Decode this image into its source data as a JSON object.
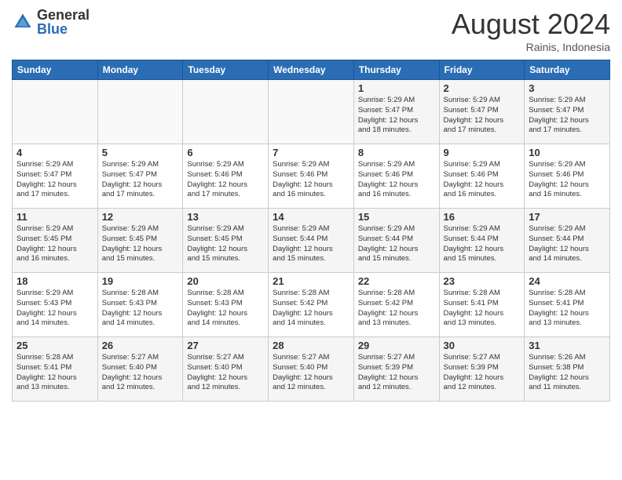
{
  "header": {
    "logo": {
      "general": "General",
      "blue": "Blue"
    },
    "title": "August 2024",
    "subtitle": "Rainis, Indonesia"
  },
  "calendar": {
    "weekdays": [
      "Sunday",
      "Monday",
      "Tuesday",
      "Wednesday",
      "Thursday",
      "Friday",
      "Saturday"
    ],
    "weeks": [
      [
        {
          "day": "",
          "info": ""
        },
        {
          "day": "",
          "info": ""
        },
        {
          "day": "",
          "info": ""
        },
        {
          "day": "",
          "info": ""
        },
        {
          "day": "1",
          "info": "Sunrise: 5:29 AM\nSunset: 5:47 PM\nDaylight: 12 hours\nand 18 minutes."
        },
        {
          "day": "2",
          "info": "Sunrise: 5:29 AM\nSunset: 5:47 PM\nDaylight: 12 hours\nand 17 minutes."
        },
        {
          "day": "3",
          "info": "Sunrise: 5:29 AM\nSunset: 5:47 PM\nDaylight: 12 hours\nand 17 minutes."
        }
      ],
      [
        {
          "day": "4",
          "info": "Sunrise: 5:29 AM\nSunset: 5:47 PM\nDaylight: 12 hours\nand 17 minutes."
        },
        {
          "day": "5",
          "info": "Sunrise: 5:29 AM\nSunset: 5:47 PM\nDaylight: 12 hours\nand 17 minutes."
        },
        {
          "day": "6",
          "info": "Sunrise: 5:29 AM\nSunset: 5:46 PM\nDaylight: 12 hours\nand 17 minutes."
        },
        {
          "day": "7",
          "info": "Sunrise: 5:29 AM\nSunset: 5:46 PM\nDaylight: 12 hours\nand 16 minutes."
        },
        {
          "day": "8",
          "info": "Sunrise: 5:29 AM\nSunset: 5:46 PM\nDaylight: 12 hours\nand 16 minutes."
        },
        {
          "day": "9",
          "info": "Sunrise: 5:29 AM\nSunset: 5:46 PM\nDaylight: 12 hours\nand 16 minutes."
        },
        {
          "day": "10",
          "info": "Sunrise: 5:29 AM\nSunset: 5:46 PM\nDaylight: 12 hours\nand 16 minutes."
        }
      ],
      [
        {
          "day": "11",
          "info": "Sunrise: 5:29 AM\nSunset: 5:45 PM\nDaylight: 12 hours\nand 16 minutes."
        },
        {
          "day": "12",
          "info": "Sunrise: 5:29 AM\nSunset: 5:45 PM\nDaylight: 12 hours\nand 15 minutes."
        },
        {
          "day": "13",
          "info": "Sunrise: 5:29 AM\nSunset: 5:45 PM\nDaylight: 12 hours\nand 15 minutes."
        },
        {
          "day": "14",
          "info": "Sunrise: 5:29 AM\nSunset: 5:44 PM\nDaylight: 12 hours\nand 15 minutes."
        },
        {
          "day": "15",
          "info": "Sunrise: 5:29 AM\nSunset: 5:44 PM\nDaylight: 12 hours\nand 15 minutes."
        },
        {
          "day": "16",
          "info": "Sunrise: 5:29 AM\nSunset: 5:44 PM\nDaylight: 12 hours\nand 15 minutes."
        },
        {
          "day": "17",
          "info": "Sunrise: 5:29 AM\nSunset: 5:44 PM\nDaylight: 12 hours\nand 14 minutes."
        }
      ],
      [
        {
          "day": "18",
          "info": "Sunrise: 5:29 AM\nSunset: 5:43 PM\nDaylight: 12 hours\nand 14 minutes."
        },
        {
          "day": "19",
          "info": "Sunrise: 5:28 AM\nSunset: 5:43 PM\nDaylight: 12 hours\nand 14 minutes."
        },
        {
          "day": "20",
          "info": "Sunrise: 5:28 AM\nSunset: 5:43 PM\nDaylight: 12 hours\nand 14 minutes."
        },
        {
          "day": "21",
          "info": "Sunrise: 5:28 AM\nSunset: 5:42 PM\nDaylight: 12 hours\nand 14 minutes."
        },
        {
          "day": "22",
          "info": "Sunrise: 5:28 AM\nSunset: 5:42 PM\nDaylight: 12 hours\nand 13 minutes."
        },
        {
          "day": "23",
          "info": "Sunrise: 5:28 AM\nSunset: 5:41 PM\nDaylight: 12 hours\nand 13 minutes."
        },
        {
          "day": "24",
          "info": "Sunrise: 5:28 AM\nSunset: 5:41 PM\nDaylight: 12 hours\nand 13 minutes."
        }
      ],
      [
        {
          "day": "25",
          "info": "Sunrise: 5:28 AM\nSunset: 5:41 PM\nDaylight: 12 hours\nand 13 minutes."
        },
        {
          "day": "26",
          "info": "Sunrise: 5:27 AM\nSunset: 5:40 PM\nDaylight: 12 hours\nand 12 minutes."
        },
        {
          "day": "27",
          "info": "Sunrise: 5:27 AM\nSunset: 5:40 PM\nDaylight: 12 hours\nand 12 minutes."
        },
        {
          "day": "28",
          "info": "Sunrise: 5:27 AM\nSunset: 5:40 PM\nDaylight: 12 hours\nand 12 minutes."
        },
        {
          "day": "29",
          "info": "Sunrise: 5:27 AM\nSunset: 5:39 PM\nDaylight: 12 hours\nand 12 minutes."
        },
        {
          "day": "30",
          "info": "Sunrise: 5:27 AM\nSunset: 5:39 PM\nDaylight: 12 hours\nand 12 minutes."
        },
        {
          "day": "31",
          "info": "Sunrise: 5:26 AM\nSunset: 5:38 PM\nDaylight: 12 hours\nand 11 minutes."
        }
      ]
    ]
  }
}
